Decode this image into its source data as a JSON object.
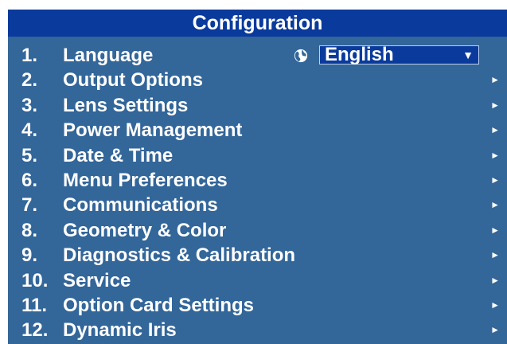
{
  "window": {
    "title": "Configuration"
  },
  "colors": {
    "panel": "#336699",
    "title_bar": "#0a3a9c",
    "text": "#ffffff"
  },
  "menu": {
    "items": [
      {
        "number": "1.",
        "label": "Language",
        "control": "dropdown",
        "icon": "globe-icon"
      },
      {
        "number": "2.",
        "label": "Output Options",
        "icon": "submenu-arrow-icon"
      },
      {
        "number": "3.",
        "label": "Lens Settings",
        "icon": "submenu-arrow-icon"
      },
      {
        "number": "4.",
        "label": "Power Management",
        "icon": "submenu-arrow-icon"
      },
      {
        "number": "5.",
        "label": "Date & Time",
        "icon": "submenu-arrow-icon"
      },
      {
        "number": "6.",
        "label": "Menu Preferences",
        "icon": "submenu-arrow-icon"
      },
      {
        "number": "7.",
        "label": "Communications",
        "icon": "submenu-arrow-icon"
      },
      {
        "number": "8.",
        "label": "Geometry & Color",
        "icon": "submenu-arrow-icon"
      },
      {
        "number": "9.",
        "label": "Diagnostics & Calibration",
        "icon": "submenu-arrow-icon"
      },
      {
        "number": "10.",
        "label": "Service",
        "icon": "submenu-arrow-icon"
      },
      {
        "number": "11.",
        "label": "Option Card Settings",
        "icon": "submenu-arrow-icon"
      },
      {
        "number": "12.",
        "label": "Dynamic Iris",
        "icon": "submenu-arrow-icon"
      }
    ]
  },
  "language_select": {
    "value": "English",
    "icon": "chevron-down-icon"
  },
  "glyphs": {
    "submenu_arrow": "►",
    "dropdown_arrow": "▼"
  }
}
